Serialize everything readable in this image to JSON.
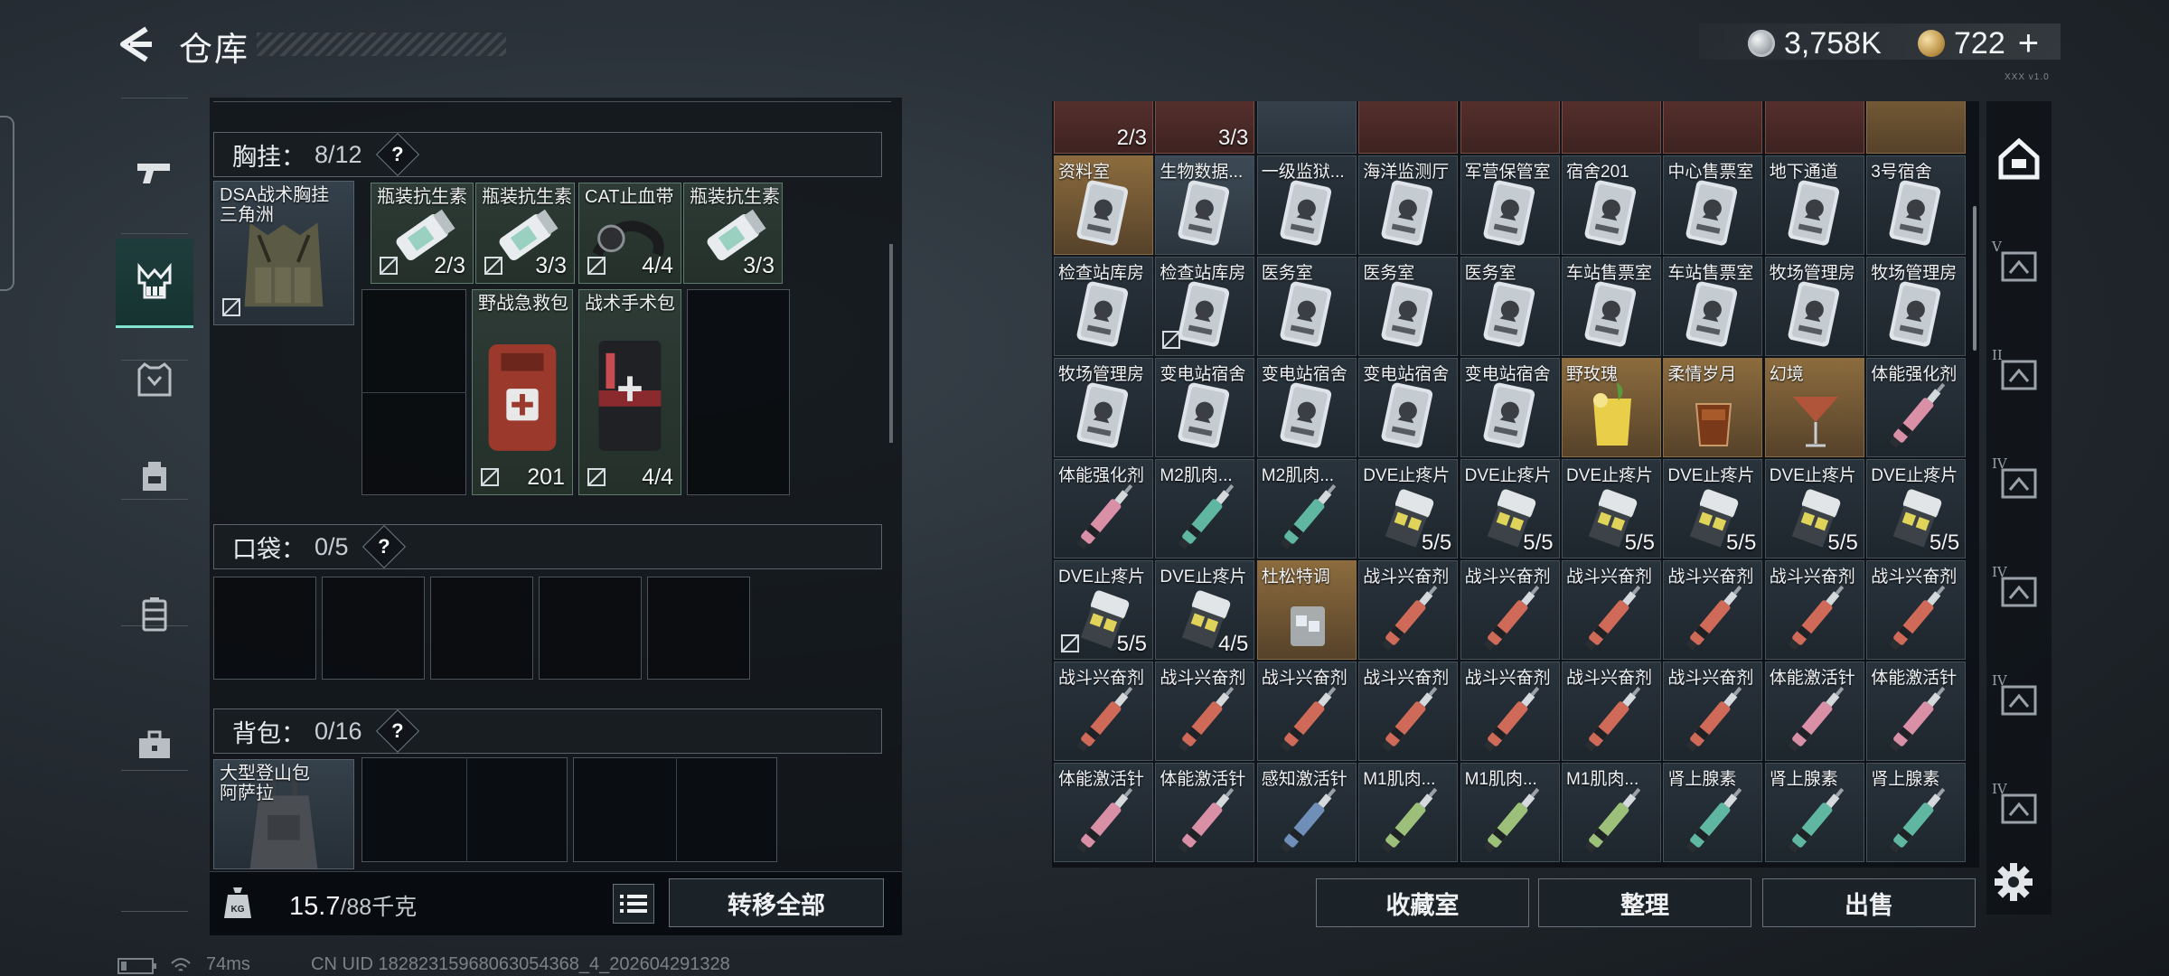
{
  "header": {
    "title": "仓库",
    "silver_amount": "3,758K",
    "gold_amount": "722",
    "plus_label": "+",
    "version_mark": "XXX v1.0"
  },
  "sidebar": {
    "items": [
      {
        "icon": "pistol-icon",
        "active": false
      },
      {
        "icon": "chest-rig-icon",
        "active": true
      },
      {
        "icon": "armor-vest-icon",
        "active": false
      },
      {
        "icon": "backpack-icon",
        "active": false
      },
      {
        "icon": "case-icon",
        "active": false
      },
      {
        "icon": "toolbox-icon",
        "active": false
      }
    ]
  },
  "gear": {
    "chest_rig": {
      "label": "胸挂：",
      "count": "8/12",
      "equipped_name": "DSA战术胸挂",
      "equipped_sub": "三角洲",
      "items": [
        {
          "name": "瓶装抗生素",
          "qty": "2/3",
          "locked": true
        },
        {
          "name": "瓶装抗生素",
          "qty": "3/3",
          "locked": true
        },
        {
          "name": "CAT止血带",
          "qty": "4/4",
          "locked": true
        },
        {
          "name": "瓶装抗生素",
          "qty": "3/3",
          "locked": false
        },
        {
          "name": "野战急救包",
          "qty": "201",
          "locked": true
        },
        {
          "name": "战术手术包",
          "qty": "4/4",
          "locked": true
        }
      ]
    },
    "pockets": {
      "label": "口袋：",
      "count": "0/5"
    },
    "backpack": {
      "label": "背包：",
      "count": "0/16",
      "equipped_name": "大型登山包",
      "equipped_sub": "阿萨拉"
    },
    "weight": {
      "current": "15.7",
      "capacity": "/88千克",
      "kg_icon_label": "KG"
    },
    "transfer_all_label": "转移全部",
    "help_symbol": "?"
  },
  "storage": {
    "top_partial_qty": [
      "2/3",
      "3/3"
    ],
    "rows": [
      [
        {
          "name": "资料室",
          "type": "card-gold"
        },
        {
          "name": "生物数据...",
          "type": "card-mint"
        },
        {
          "name": "一级监狱...",
          "type": "card"
        },
        {
          "name": "海洋监测厅",
          "type": "card"
        },
        {
          "name": "军营保管室",
          "type": "card"
        },
        {
          "name": "宿舍201",
          "type": "card"
        },
        {
          "name": "中心售票室",
          "type": "card"
        },
        {
          "name": "地下通道",
          "type": "card"
        },
        {
          "name": "3号宿舍",
          "type": "card"
        }
      ],
      [
        {
          "name": "检查站库房",
          "type": "card"
        },
        {
          "name": "检查站库房",
          "type": "card",
          "locked": true
        },
        {
          "name": "医务室",
          "type": "card"
        },
        {
          "name": "医务室",
          "type": "card"
        },
        {
          "name": "医务室",
          "type": "card"
        },
        {
          "name": "车站售票室",
          "type": "card"
        },
        {
          "name": "车站售票室",
          "type": "card"
        },
        {
          "name": "牧场管理房",
          "type": "card"
        },
        {
          "name": "牧场管理房",
          "type": "card"
        }
      ],
      [
        {
          "name": "牧场管理房",
          "type": "card"
        },
        {
          "name": "变电站宿舍",
          "type": "card"
        },
        {
          "name": "变电站宿舍",
          "type": "card"
        },
        {
          "name": "变电站宿舍",
          "type": "card"
        },
        {
          "name": "变电站宿舍",
          "type": "card"
        },
        {
          "name": "野玫瑰",
          "type": "drink-yellow"
        },
        {
          "name": "柔情岁月",
          "type": "drink-amber"
        },
        {
          "name": "幻境",
          "type": "drink-martini"
        },
        {
          "name": "体能强化剂",
          "type": "syringe-pink"
        }
      ],
      [
        {
          "name": "体能强化剂",
          "type": "syringe-pink"
        },
        {
          "name": "M2肌肉...",
          "type": "syringe-teal"
        },
        {
          "name": "M2肌肉...",
          "type": "syringe-teal"
        },
        {
          "name": "DVE止疼片",
          "type": "pills",
          "qty": "5/5"
        },
        {
          "name": "DVE止疼片",
          "type": "pills",
          "qty": "5/5"
        },
        {
          "name": "DVE止疼片",
          "type": "pills",
          "qty": "5/5"
        },
        {
          "name": "DVE止疼片",
          "type": "pills",
          "qty": "5/5"
        },
        {
          "name": "DVE止疼片",
          "type": "pills",
          "qty": "5/5"
        },
        {
          "name": "DVE止疼片",
          "type": "pills",
          "qty": "5/5"
        }
      ],
      [
        {
          "name": "DVE止疼片",
          "type": "pills",
          "qty": "5/5",
          "locked": true
        },
        {
          "name": "DVE止疼片",
          "type": "pills",
          "qty": "4/5"
        },
        {
          "name": "杜松特调",
          "type": "drink-glass"
        },
        {
          "name": "战斗兴奋剂",
          "type": "syringe-red"
        },
        {
          "name": "战斗兴奋剂",
          "type": "syringe-red"
        },
        {
          "name": "战斗兴奋剂",
          "type": "syringe-red"
        },
        {
          "name": "战斗兴奋剂",
          "type": "syringe-red"
        },
        {
          "name": "战斗兴奋剂",
          "type": "syringe-red"
        },
        {
          "name": "战斗兴奋剂",
          "type": "syringe-red"
        }
      ],
      [
        {
          "name": "战斗兴奋剂",
          "type": "syringe-red"
        },
        {
          "name": "战斗兴奋剂",
          "type": "syringe-red"
        },
        {
          "name": "战斗兴奋剂",
          "type": "syringe-red"
        },
        {
          "name": "战斗兴奋剂",
          "type": "syringe-red"
        },
        {
          "name": "战斗兴奋剂",
          "type": "syringe-red"
        },
        {
          "name": "战斗兴奋剂",
          "type": "syringe-red"
        },
        {
          "name": "战斗兴奋剂",
          "type": "syringe-red"
        },
        {
          "name": "体能激活针",
          "type": "syringe-pink"
        },
        {
          "name": "体能激活针",
          "type": "syringe-pink"
        }
      ],
      [
        {
          "name": "体能激活针",
          "type": "syringe-pink"
        },
        {
          "name": "体能激活针",
          "type": "syringe-pink"
        },
        {
          "name": "感知激活针",
          "type": "syringe-blue"
        },
        {
          "name": "M1肌肉...",
          "type": "syringe-green"
        },
        {
          "name": "M1肌肉...",
          "type": "syringe-green"
        },
        {
          "name": "M1肌肉...",
          "type": "syringe-green"
        },
        {
          "name": "肾上腺素",
          "type": "syringe-teal"
        },
        {
          "name": "肾上腺素",
          "type": "syringe-teal"
        },
        {
          "name": "肾上腺素",
          "type": "syringe-teal"
        }
      ]
    ],
    "buttons": {
      "collection": "收藏室",
      "sort": "整理",
      "sell": "出售"
    }
  },
  "right_tabs": [
    {
      "icon": "home-base-icon",
      "roman": ""
    },
    {
      "icon": "storage-expansion-icon",
      "roman": "V"
    },
    {
      "icon": "folder-icon",
      "roman": "II"
    },
    {
      "icon": "folder-icon",
      "roman": "IV"
    },
    {
      "icon": "add-storage-icon",
      "roman": "IV"
    },
    {
      "icon": "frame-icon",
      "roman": "IV"
    },
    {
      "icon": "frame-icon",
      "roman": "IV"
    }
  ],
  "status": {
    "ping": "74ms",
    "uid": "CN UID 18282315968063054368_4_202604291328"
  },
  "colors": {
    "accent_teal": "#7fe5d2",
    "item_green": "#2e3b36",
    "panel_bg": "#0e1216"
  }
}
